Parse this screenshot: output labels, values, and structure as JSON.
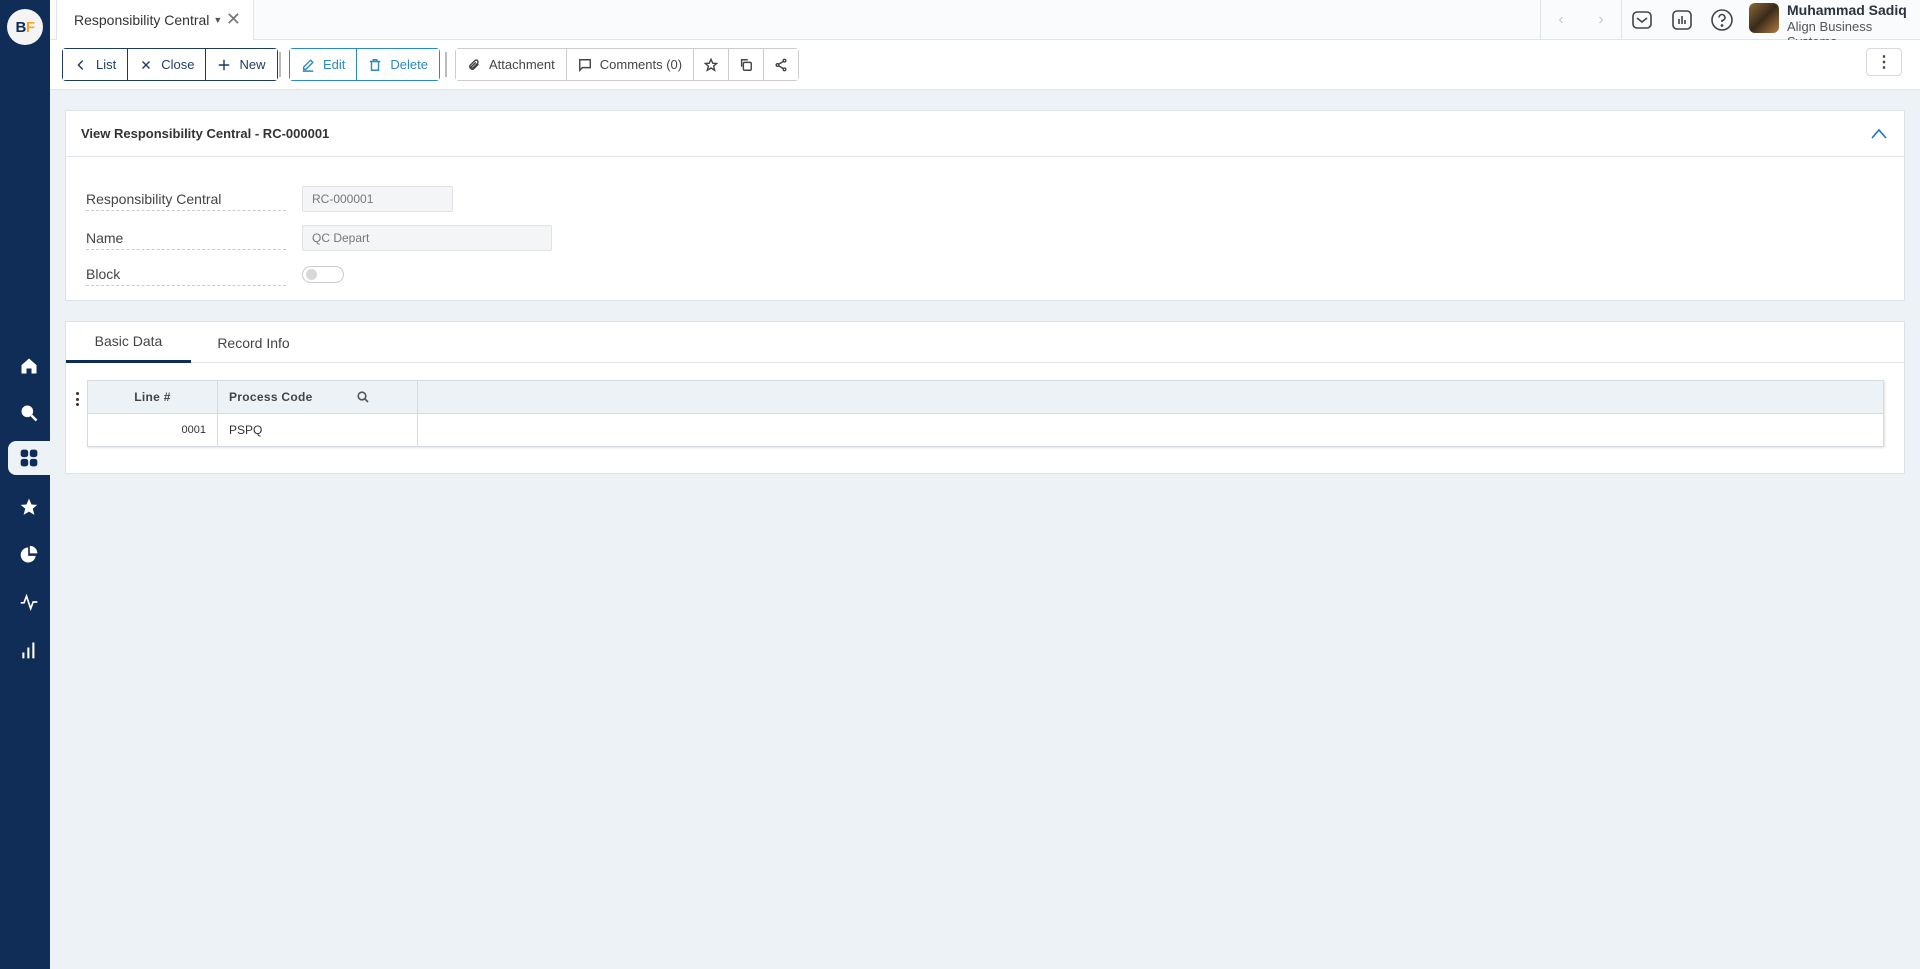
{
  "app": {
    "logo_left": "B",
    "logo_right": "F"
  },
  "sidebar": {
    "items": [
      {
        "name": "home",
        "icon": "home-icon",
        "active": false
      },
      {
        "name": "search",
        "icon": "search-icon",
        "active": false
      },
      {
        "name": "apps",
        "icon": "grid-icon",
        "active": true
      },
      {
        "name": "favorites",
        "icon": "star-icon",
        "active": false
      },
      {
        "name": "analytics",
        "icon": "pie-chart-icon",
        "active": false
      },
      {
        "name": "activity",
        "icon": "pulse-icon",
        "active": false
      },
      {
        "name": "reports",
        "icon": "bar-chart-icon",
        "active": false
      }
    ]
  },
  "topbar": {
    "tab_label": "Responsibility Central",
    "tab_close": "✕",
    "prev_arrow": "‹",
    "next_arrow": "›",
    "user_name": "Muhammad Sadiq",
    "user_company": "Align Business Systems"
  },
  "toolbar": {
    "list_label": "List",
    "close_label": "Close",
    "new_label": "New",
    "edit_label": "Edit",
    "delete_label": "Delete",
    "attachment_label": "Attachment",
    "comments_label": "Comments (0)",
    "more": "⋮"
  },
  "form": {
    "title": "View Responsibility Central - RC-000001",
    "fields": [
      {
        "label": "Responsibility Central",
        "value": "RC-000001"
      },
      {
        "label": "Name",
        "value": "QC Depart"
      },
      {
        "label": "Block",
        "value": false
      }
    ]
  },
  "detail": {
    "tabs": [
      {
        "label": "Basic Data",
        "active": true
      },
      {
        "label": "Record Info",
        "active": false
      }
    ],
    "columns": [
      "Line #",
      "Process Code"
    ],
    "rows": [
      {
        "line": "0001",
        "process_code": "PSPQ"
      }
    ]
  }
}
